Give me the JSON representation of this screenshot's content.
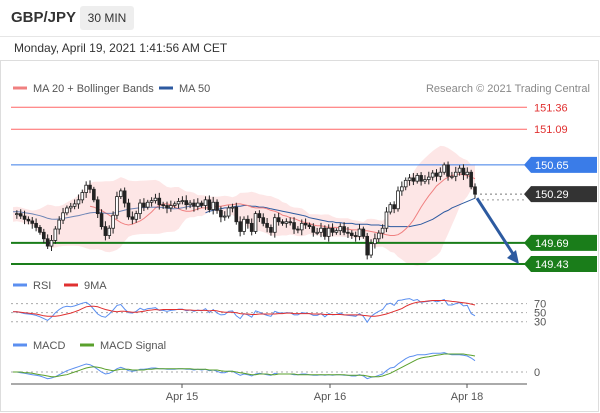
{
  "header": {
    "pair": "GBP/JPY",
    "timeframe": "30 MIN",
    "timestamp": "Monday, April 19, 2021 1:41:56 AM CET"
  },
  "legend": {
    "ma20_label": "MA 20 + Bollinger Bands",
    "ma50_label": "MA 50",
    "credit": "Research © 2021 Trading Central"
  },
  "colors": {
    "ma20": "#f08080",
    "bollinger_fill": "#fde3e3",
    "ma50": "#2d5aa0",
    "resistance": "#ff6666",
    "pivot": "#3a7ce8",
    "support": "#1a7d1a",
    "current": "#333333",
    "rsi": "#5b8ff0",
    "rsi_signal": "#e03030",
    "macd": "#5b8ff0",
    "macd_signal": "#5aa02c",
    "arrow": "#2d5aa0"
  },
  "chart_data": [
    {
      "type": "candlestick",
      "name": "price",
      "x_tick_labels": [
        "Apr 15",
        "Apr 16",
        "Apr 18"
      ],
      "ylim": [
        149.38,
        151.45
      ],
      "levels": [
        {
          "value": 151.36,
          "label": "151.36",
          "kind": "resistance"
        },
        {
          "value": 151.09,
          "label": "151.09",
          "kind": "resistance"
        },
        {
          "value": 150.65,
          "label": "150.65",
          "kind": "pivot"
        },
        {
          "value": 150.29,
          "label": "150.29",
          "kind": "current"
        },
        {
          "value": 149.69,
          "label": "149.69",
          "kind": "support"
        },
        {
          "value": 149.43,
          "label": "149.43",
          "kind": "support"
        }
      ],
      "close": [
        150.04,
        150.05,
        150.02,
        149.98,
        149.96,
        149.93,
        149.88,
        149.82,
        149.74,
        149.65,
        149.72,
        149.86,
        149.97,
        150.06,
        150.12,
        150.14,
        150.17,
        150.22,
        150.31,
        150.4,
        150.35,
        150.22,
        150.05,
        149.89,
        149.78,
        149.87,
        150.03,
        150.26,
        150.33,
        150.18,
        150.01,
        149.98,
        150.05,
        150.18,
        150.13,
        150.19,
        150.21,
        150.24,
        150.16,
        150.15,
        150.12,
        150.15,
        150.17,
        150.2,
        150.21,
        150.16,
        150.18,
        150.14,
        150.18,
        150.15,
        150.22,
        150.1,
        150.19,
        150.09,
        150.01,
        150.02,
        150.12,
        150.13,
        149.95,
        149.83,
        149.98,
        149.93,
        149.83,
        150.05,
        150.0,
        149.93,
        149.88,
        149.82,
        150.0,
        149.95,
        149.93,
        149.95,
        149.94,
        149.86,
        149.85,
        149.93,
        149.91,
        149.89,
        149.82,
        149.82,
        149.87,
        149.77,
        149.87,
        149.82,
        149.84,
        149.89,
        149.82,
        149.81,
        149.78,
        149.77,
        149.86,
        149.77,
        149.54,
        149.68,
        149.74,
        149.81,
        149.87,
        150.07,
        150.16,
        150.11,
        150.33,
        150.38,
        150.46,
        150.49,
        150.45,
        150.52,
        150.45,
        150.47,
        150.5,
        150.55,
        150.51,
        150.56,
        150.65,
        150.51,
        150.51,
        150.56,
        150.61,
        150.53,
        150.56,
        150.38,
        150.29
      ],
      "ma20": [
        150.14,
        150.13,
        150.11,
        150.09,
        150.06,
        150.03,
        150.0,
        149.97,
        149.94,
        149.92,
        149.91,
        149.92,
        149.94,
        149.96,
        149.99,
        150.03,
        150.07,
        150.12,
        150.15,
        150.17,
        150.17,
        150.16,
        150.13,
        150.11,
        150.09,
        150.08,
        150.08,
        150.09,
        150.11,
        150.12,
        150.12,
        150.12,
        150.13,
        150.14,
        150.14,
        150.15,
        150.16,
        150.16,
        150.17,
        150.17,
        150.16,
        150.15,
        150.13,
        150.12,
        150.12,
        150.12,
        150.11,
        150.09,
        150.08,
        150.06,
        150.03,
        150.02,
        150.0,
        149.99,
        149.97,
        149.95,
        149.94,
        149.93,
        149.91,
        149.9,
        149.9,
        149.89,
        149.88,
        149.88,
        149.88,
        149.87,
        149.86,
        149.86,
        149.85,
        149.85,
        149.85,
        149.84,
        149.84,
        149.83,
        149.82,
        149.81,
        149.8,
        149.79,
        149.78,
        149.78,
        149.79,
        149.82,
        149.86,
        149.91,
        149.97,
        150.05,
        150.13,
        150.2,
        150.27,
        150.33,
        150.39,
        150.43,
        150.47,
        150.5,
        150.52,
        150.53,
        150.54,
        150.53,
        150.52,
        150.5,
        150.48
      ],
      "ma20_start_index": 20,
      "ma50": [
        150.06,
        150.08,
        150.09,
        150.1,
        150.11,
        150.12,
        150.12,
        150.13,
        150.14,
        150.14,
        150.15,
        150.15,
        150.14,
        150.14,
        150.13,
        150.13,
        150.12,
        150.11,
        150.1,
        150.09,
        150.08,
        150.07,
        150.06,
        150.05,
        150.04,
        150.03,
        150.02,
        150.0,
        149.99,
        149.98,
        149.97,
        149.96,
        149.95,
        149.95,
        149.94,
        149.94,
        149.93,
        149.93,
        149.93,
        149.92,
        149.92,
        149.92,
        149.92,
        149.91,
        149.91,
        149.91,
        149.9,
        149.9,
        149.89,
        149.89,
        149.89,
        149.89,
        149.89,
        149.89,
        149.9,
        149.91,
        149.92,
        149.94,
        149.96,
        149.98,
        150.01,
        150.04,
        150.07,
        150.09,
        150.12,
        150.14,
        150.16,
        150.18,
        150.2,
        150.22,
        150.24
      ],
      "ma50_start_index": 50
    },
    {
      "type": "line",
      "name": "RSI",
      "yticks": [
        70,
        50,
        30
      ],
      "series": [
        {
          "name": "RSI",
          "values": [
            52,
            52,
            50,
            48,
            47,
            46,
            44,
            41,
            37,
            33,
            40,
            50,
            57,
            62,
            64,
            63,
            65,
            68,
            71,
            73,
            67,
            57,
            47,
            42,
            40,
            47,
            56,
            66,
            68,
            58,
            50,
            49,
            53,
            60,
            56,
            59,
            60,
            61,
            55,
            55,
            53,
            55,
            56,
            58,
            58,
            54,
            56,
            53,
            56,
            54,
            59,
            50,
            57,
            49,
            45,
            46,
            53,
            54,
            43,
            37,
            48,
            45,
            40,
            54,
            51,
            47,
            44,
            42,
            53,
            50,
            49,
            50,
            50,
            45,
            45,
            50,
            49,
            48,
            44,
            44,
            48,
            41,
            48,
            45,
            46,
            49,
            45,
            44,
            43,
            42,
            48,
            42,
            29,
            42,
            48,
            53,
            57,
            68,
            71,
            66,
            77,
            78,
            80,
            81,
            77,
            79,
            73,
            74,
            75,
            77,
            74,
            76,
            79,
            67,
            67,
            70,
            72,
            65,
            66,
            48,
            43
          ]
        },
        {
          "name": "9MA",
          "values": [
            52,
            52,
            51,
            50,
            49,
            48,
            47,
            45,
            43,
            42,
            42,
            42,
            43,
            45,
            47,
            49,
            52,
            55,
            59,
            63,
            64,
            64,
            63,
            60,
            57,
            55,
            53,
            52,
            53,
            53,
            52,
            51,
            51,
            52,
            53,
            55,
            56,
            57,
            56,
            57,
            57,
            57,
            57,
            57,
            57,
            56,
            56,
            55,
            55,
            55,
            55,
            54,
            55,
            54,
            52,
            51,
            51,
            51,
            50,
            48,
            47,
            47,
            46,
            46,
            47,
            47,
            47,
            47,
            47,
            48,
            48,
            49,
            49,
            48,
            48,
            48,
            48,
            48,
            47,
            47,
            47,
            46,
            46,
            46,
            46,
            46,
            45,
            45,
            45,
            45,
            45,
            44,
            43,
            42,
            42,
            43,
            45,
            47,
            50,
            53,
            56,
            59,
            64,
            68,
            71,
            73,
            74,
            75,
            76,
            77,
            77,
            77,
            77,
            76,
            75,
            74,
            73,
            72,
            71,
            69,
            67
          ]
        }
      ]
    },
    {
      "type": "line",
      "name": "MACD",
      "yticks": [
        0
      ],
      "series": [
        {
          "name": "MACD",
          "values": [
            0.0,
            0.0,
            -0.01,
            -0.02,
            -0.03,
            -0.04,
            -0.05,
            -0.06,
            -0.08,
            -0.1,
            -0.09,
            -0.07,
            -0.04,
            -0.01,
            0.02,
            0.04,
            0.06,
            0.08,
            0.1,
            0.12,
            0.11,
            0.08,
            0.04,
            0.0,
            -0.03,
            -0.02,
            0.01,
            0.05,
            0.07,
            0.05,
            0.02,
            0.01,
            0.02,
            0.04,
            0.04,
            0.05,
            0.06,
            0.06,
            0.05,
            0.05,
            0.04,
            0.04,
            0.04,
            0.05,
            0.05,
            0.04,
            0.04,
            0.03,
            0.04,
            0.03,
            0.04,
            0.02,
            0.03,
            0.01,
            -0.01,
            -0.01,
            0.01,
            0.01,
            -0.02,
            -0.05,
            -0.03,
            -0.04,
            -0.06,
            -0.03,
            -0.02,
            -0.03,
            -0.04,
            -0.05,
            -0.02,
            -0.03,
            -0.03,
            -0.03,
            -0.03,
            -0.04,
            -0.04,
            -0.03,
            -0.03,
            -0.04,
            -0.05,
            -0.05,
            -0.04,
            -0.05,
            -0.04,
            -0.05,
            -0.04,
            -0.04,
            -0.05,
            -0.05,
            -0.06,
            -0.06,
            -0.04,
            -0.06,
            -0.1,
            -0.08,
            -0.07,
            -0.05,
            -0.03,
            0.02,
            0.06,
            0.07,
            0.12,
            0.16,
            0.2,
            0.23,
            0.24,
            0.26,
            0.26,
            0.26,
            0.27,
            0.28,
            0.28,
            0.28,
            0.29,
            0.27,
            0.26,
            0.26,
            0.26,
            0.25,
            0.24,
            0.21,
            0.17
          ]
        },
        {
          "name": "MACD Signal",
          "values": [
            0.0,
            0.0,
            0.0,
            -0.01,
            -0.01,
            -0.02,
            -0.03,
            -0.04,
            -0.05,
            -0.06,
            -0.07,
            -0.07,
            -0.06,
            -0.05,
            -0.04,
            -0.02,
            0.0,
            0.02,
            0.04,
            0.06,
            0.07,
            0.08,
            0.07,
            0.06,
            0.04,
            0.03,
            0.02,
            0.03,
            0.04,
            0.04,
            0.04,
            0.03,
            0.03,
            0.03,
            0.03,
            0.04,
            0.04,
            0.05,
            0.05,
            0.05,
            0.05,
            0.05,
            0.05,
            0.05,
            0.05,
            0.05,
            0.05,
            0.04,
            0.04,
            0.04,
            0.04,
            0.03,
            0.03,
            0.03,
            0.02,
            0.01,
            0.01,
            0.01,
            0.0,
            -0.01,
            -0.02,
            -0.03,
            -0.04,
            -0.04,
            -0.03,
            -0.03,
            -0.03,
            -0.04,
            -0.04,
            -0.03,
            -0.03,
            -0.03,
            -0.03,
            -0.03,
            -0.04,
            -0.04,
            -0.04,
            -0.04,
            -0.04,
            -0.04,
            -0.04,
            -0.04,
            -0.04,
            -0.04,
            -0.04,
            -0.04,
            -0.04,
            -0.05,
            -0.05,
            -0.05,
            -0.05,
            -0.05,
            -0.06,
            -0.07,
            -0.07,
            -0.07,
            -0.06,
            -0.04,
            -0.02,
            0.01,
            0.04,
            0.07,
            0.1,
            0.13,
            0.16,
            0.19,
            0.21,
            0.22,
            0.23,
            0.24,
            0.25,
            0.26,
            0.27,
            0.27,
            0.27,
            0.27,
            0.27,
            0.27,
            0.26,
            0.25,
            0.24
          ]
        }
      ]
    }
  ]
}
